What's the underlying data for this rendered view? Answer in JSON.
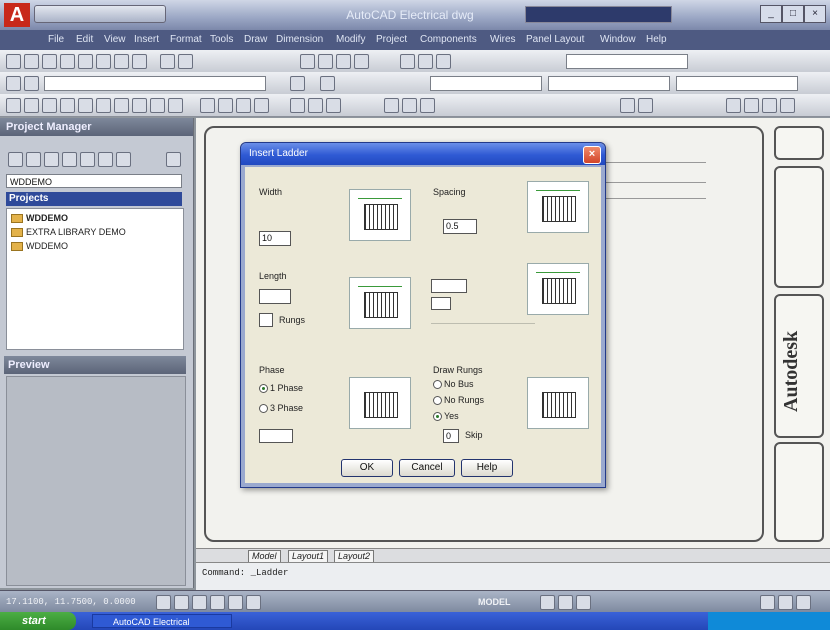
{
  "window": {
    "title": "AutoCAD Electrical   dwg"
  },
  "menubar": {
    "items": [
      "File",
      "Edit",
      "View",
      "Insert",
      "Format",
      "Tools",
      "Draw",
      "Dimension",
      "Modify",
      "Project",
      "Components",
      "Wires",
      "Panel Layout",
      "Window",
      "Help"
    ]
  },
  "project_manager": {
    "title": "Project Manager",
    "project_combo": "WDDEMO",
    "projects_label": "Projects",
    "tree": [
      "WDDEMO",
      "EXTRA LIBRARY DEMO",
      "WDDEMO"
    ],
    "preview_title": "Preview"
  },
  "drawing": {
    "brand": "Autodesk"
  },
  "layout_tabs": [
    "Model",
    "Layout1",
    "Layout2"
  ],
  "command": {
    "text": "Command:  _Ladder"
  },
  "status": {
    "coords": "17.1100, 11.7500, 0.0000",
    "model_label": "MODEL"
  },
  "taskbar": {
    "start": "start",
    "task": "AutoCAD Electrical"
  },
  "dialog": {
    "title": "Insert Ladder",
    "width_label": "Width",
    "width_value": "10",
    "spacing_label": "Spacing",
    "spacing_value": "0.5",
    "length_label": "Length",
    "rungs_label": "Rungs",
    "phase_label": "Phase",
    "phase_options": [
      "1 Phase",
      "3 Phase"
    ],
    "phase_selected": 0,
    "draw_rungs_label": "Draw Rungs",
    "draw_rungs_options": [
      "No Bus",
      "No Rungs",
      "Yes"
    ],
    "skip_label": "Skip",
    "skip_value": "0",
    "ok": "OK",
    "cancel": "Cancel",
    "help": "Help"
  },
  "colors": {
    "dialog_title": "#2f5ad4",
    "accent_red": "#c8281a",
    "taskbar": "#2447b8"
  }
}
